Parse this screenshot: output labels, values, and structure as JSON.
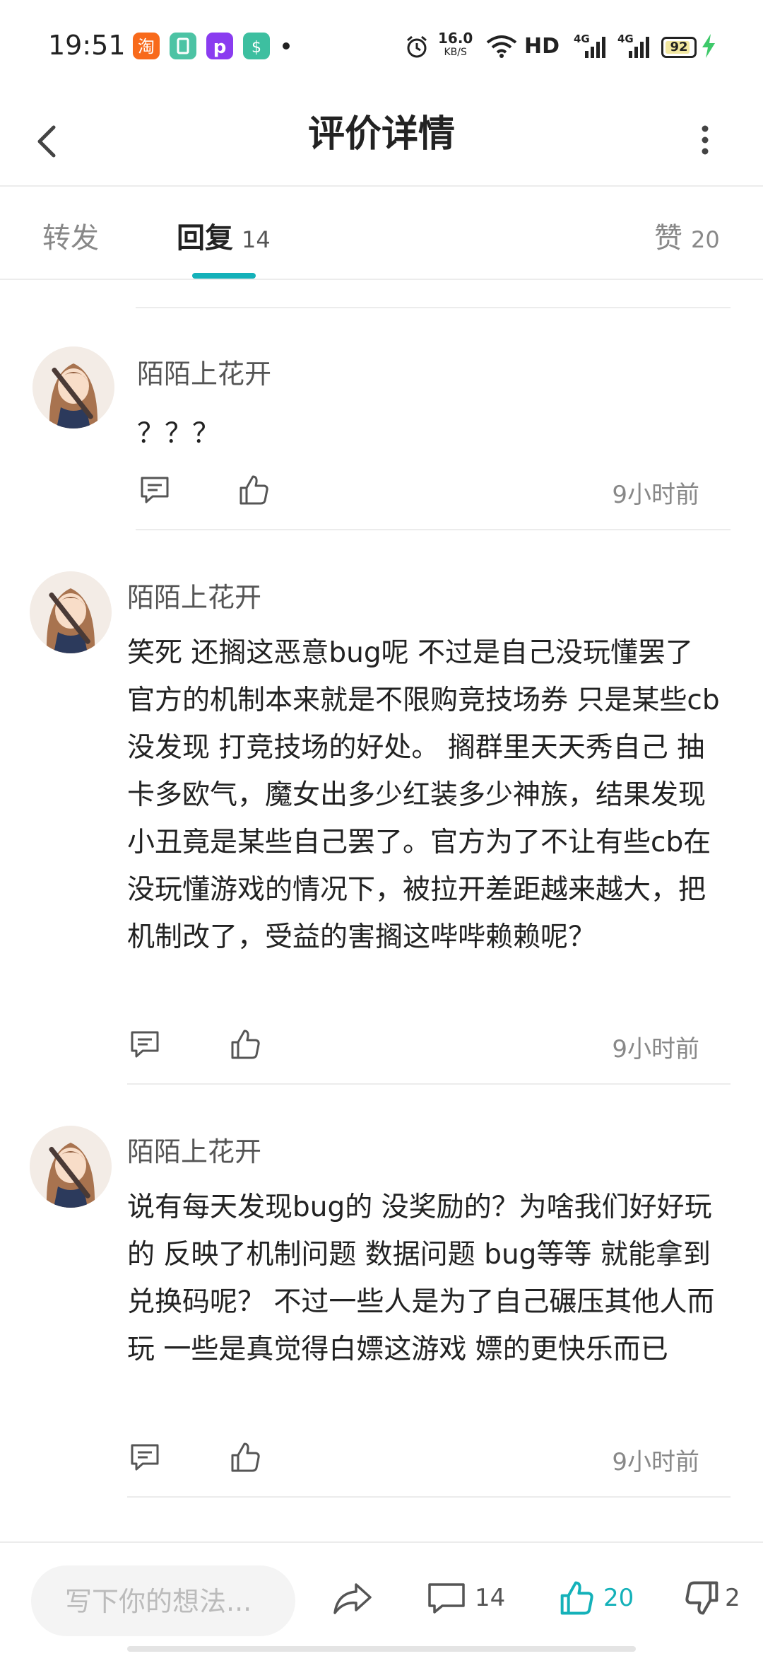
{
  "status_bar": {
    "time": "19:51",
    "net_speed_value": "16.0",
    "net_speed_unit": "KB/S",
    "hd": "HD",
    "sim1": "4G",
    "sim2": "4G",
    "battery": "92",
    "app_icons": [
      "taobao-icon",
      "app-green-icon",
      "app-purple-p-icon",
      "app-green-shield-icon"
    ],
    "colors": {
      "charging": "#3ec96a"
    }
  },
  "header": {
    "title": "评价详情"
  },
  "tabs": {
    "repost": "转发",
    "reply": "回复",
    "reply_count": "14",
    "like": "赞",
    "like_count": "20",
    "accent": "#14b1b9"
  },
  "comments": [
    {
      "author": "陌陌上花开",
      "text": "？？？",
      "time": "9小时前"
    },
    {
      "author": "陌陌上花开",
      "text": "笑死 还搁这恶意bug呢 不过是自己没玩懂罢了 官方的机制本来就是不限购竞技场券 只是某些cb没发现 打竞技场的好处。 搁群里天天秀自己 抽卡多欧气，魔女出多少红装多少神族，结果发现小丑竟是某些自己罢了。官方为了不让有些cb在没玩懂游戏的情况下，被拉开差距越来越大，把机制改了，受益的害搁这哔哔赖赖呢？",
      "time": "9小时前"
    },
    {
      "author": "陌陌上花开",
      "text": "说有每天发现bug的 没奖励的？为啥我们好好玩的 反映了机制问题 数据问题 bug等等 就能拿到兑换码呢？ 不过一些人是为了自己碾压其他人而玩 一些是真觉得白嫖这游戏 嫖的更快乐而已",
      "time": "9小时前"
    }
  ],
  "bottom_bar": {
    "input_placeholder": "写下你的想法...",
    "reply_count": "14",
    "like_count": "20",
    "dislike_count": "2"
  }
}
